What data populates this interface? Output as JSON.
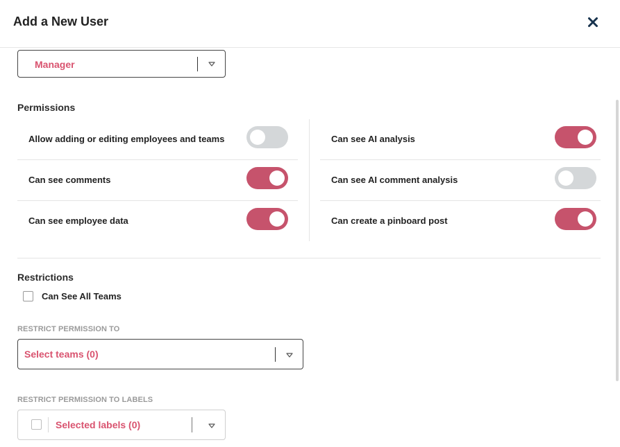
{
  "header": {
    "title": "Add a New User",
    "close_icon": "close-icon"
  },
  "role_select": {
    "value": "Manager",
    "caret_icon": "caret-down-icon"
  },
  "permissions": {
    "title": "Permissions",
    "left": [
      {
        "label": "Allow adding or editing employees and teams",
        "enabled": false
      },
      {
        "label": "Can see comments",
        "enabled": true
      },
      {
        "label": "Can see employee data",
        "enabled": true
      }
    ],
    "right": [
      {
        "label": "Can see AI analysis",
        "enabled": true
      },
      {
        "label": "Can see AI comment analysis",
        "enabled": false
      },
      {
        "label": "Can create a pinboard post",
        "enabled": true
      }
    ]
  },
  "restrictions": {
    "title": "Restrictions",
    "can_see_all_teams": {
      "label": "Can See All Teams",
      "checked": false
    },
    "restrict_teams": {
      "label": "RESTRICT PERMISSION TO",
      "value": "Select teams (0)"
    },
    "restrict_labels": {
      "label": "RESTRICT PERMISSION TO LABELS",
      "value": "Selected labels (0)"
    }
  },
  "colors": {
    "accent": "#d9536f",
    "toggle_on": "#c6536c",
    "toggle_off": "#d4d7d9"
  }
}
